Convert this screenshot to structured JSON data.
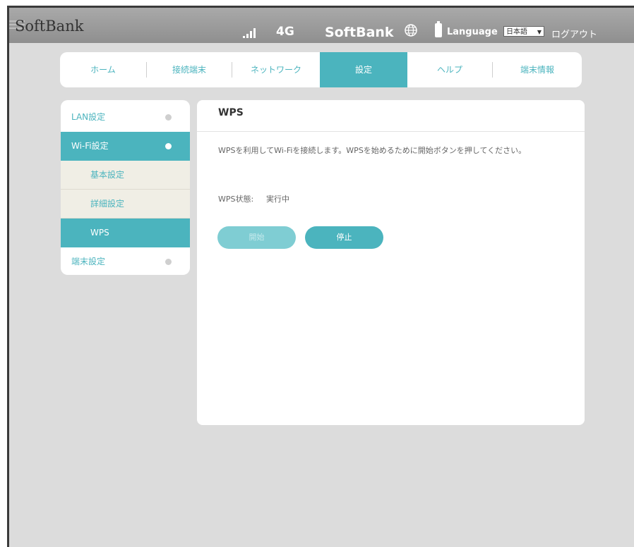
{
  "header": {
    "brand": "SoftBank",
    "network_type": "4G",
    "carrier": "SoftBank",
    "language_label": "Language",
    "language_value": "日本語",
    "logout": "ログアウト",
    "icons": [
      "signal-icon",
      "globe-icon",
      "battery-icon"
    ]
  },
  "nav": {
    "tabs": [
      {
        "label": "ホーム",
        "active": false
      },
      {
        "label": "接続端末",
        "active": false
      },
      {
        "label": "ネットワーク",
        "active": false
      },
      {
        "label": "設定",
        "active": true
      },
      {
        "label": "ヘルプ",
        "active": false
      },
      {
        "label": "端末情報",
        "active": false
      }
    ]
  },
  "sidebar": {
    "items": [
      {
        "label": "LAN設定"
      },
      {
        "label": "Wi-Fi設定"
      },
      {
        "label": "基本設定"
      },
      {
        "label": "詳細設定"
      },
      {
        "label": "WPS"
      },
      {
        "label": "端末設定"
      }
    ]
  },
  "main": {
    "title": "WPS",
    "description": "WPSを利用してWi-Fiを接続します。WPSを始めるために開始ボタンを押してください。",
    "status_label": "WPS状態:",
    "status_value": "実行中",
    "start_button": "開始",
    "stop_button": "停止"
  },
  "colors": {
    "accent": "#4bb4be",
    "header_bg": "#9a9a9a",
    "page_bg": "#dcdcdc",
    "submenu_bg": "#f0eee5"
  }
}
